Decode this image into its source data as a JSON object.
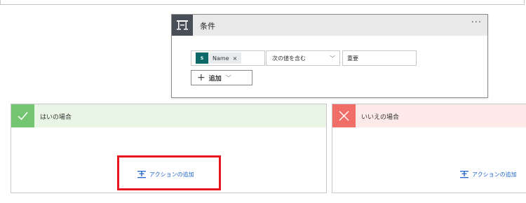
{
  "condition": {
    "title": "条件",
    "more": "···",
    "token_icon_text": "S",
    "token_label": "Name",
    "token_remove": "×",
    "operator": "次の値を含む",
    "operator_chevron": "﹀",
    "value": "重要",
    "add_plus": "+",
    "add_label": "追加",
    "add_chevron": "﹀"
  },
  "yes_branch": {
    "title": "はいの場合",
    "add_action": "アクションの追加"
  },
  "no_branch": {
    "title": "いいえの場合",
    "add_action": "アクションの追加"
  },
  "colors": {
    "yes_accent": "#74c571",
    "no_accent": "#f06e67",
    "highlight": "#e8141e",
    "link": "#2266cc"
  }
}
